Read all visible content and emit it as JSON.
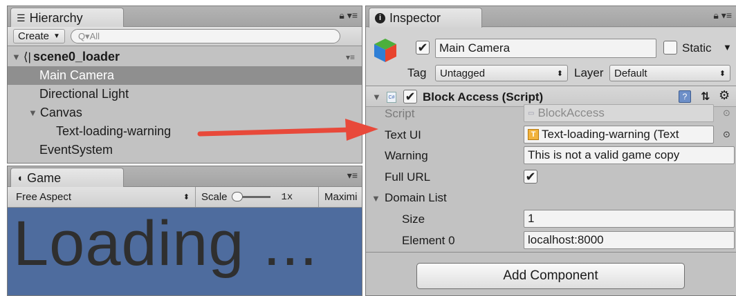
{
  "hierarchy": {
    "tab_label": "Hierarchy",
    "create_label": "Create",
    "search_placeholder": "Q▾All",
    "scene_name": "scene0_loader",
    "items": [
      {
        "label": "Main Camera",
        "selected": true
      },
      {
        "label": "Directional Light"
      },
      {
        "label": "Canvas",
        "expanded": true
      },
      {
        "label": "Text-loading-warning"
      },
      {
        "label": "EventSystem"
      }
    ]
  },
  "game": {
    "tab_label": "Game",
    "aspect_label": "Free Aspect",
    "scale_label": "Scale",
    "scale_value": "1x",
    "maximize_label": "Maximi",
    "display_text": "Loading ..."
  },
  "inspector": {
    "tab_label": "Inspector",
    "object_name": "Main Camera",
    "static_label": "Static",
    "tag_label": "Tag",
    "tag_value": "Untagged",
    "layer_label": "Layer",
    "layer_value": "Default",
    "component_title": "Block Access (Script)",
    "script_label": "Script",
    "script_value": "BlockAccess",
    "text_ui_label": "Text UI",
    "text_ui_value": "Text-loading-warning (Text",
    "warning_label": "Warning",
    "warning_value": "This is not a valid game copy",
    "full_url_label": "Full URL",
    "domain_list_label": "Domain List",
    "size_label": "Size",
    "size_value": "1",
    "element0_label": "Element 0",
    "element0_value": "localhost:8000",
    "add_component_label": "Add Component"
  },
  "colors": {
    "arrow": "#e8493a",
    "game_background": "#4e6c9e",
    "selection": "#8f8f8f"
  }
}
